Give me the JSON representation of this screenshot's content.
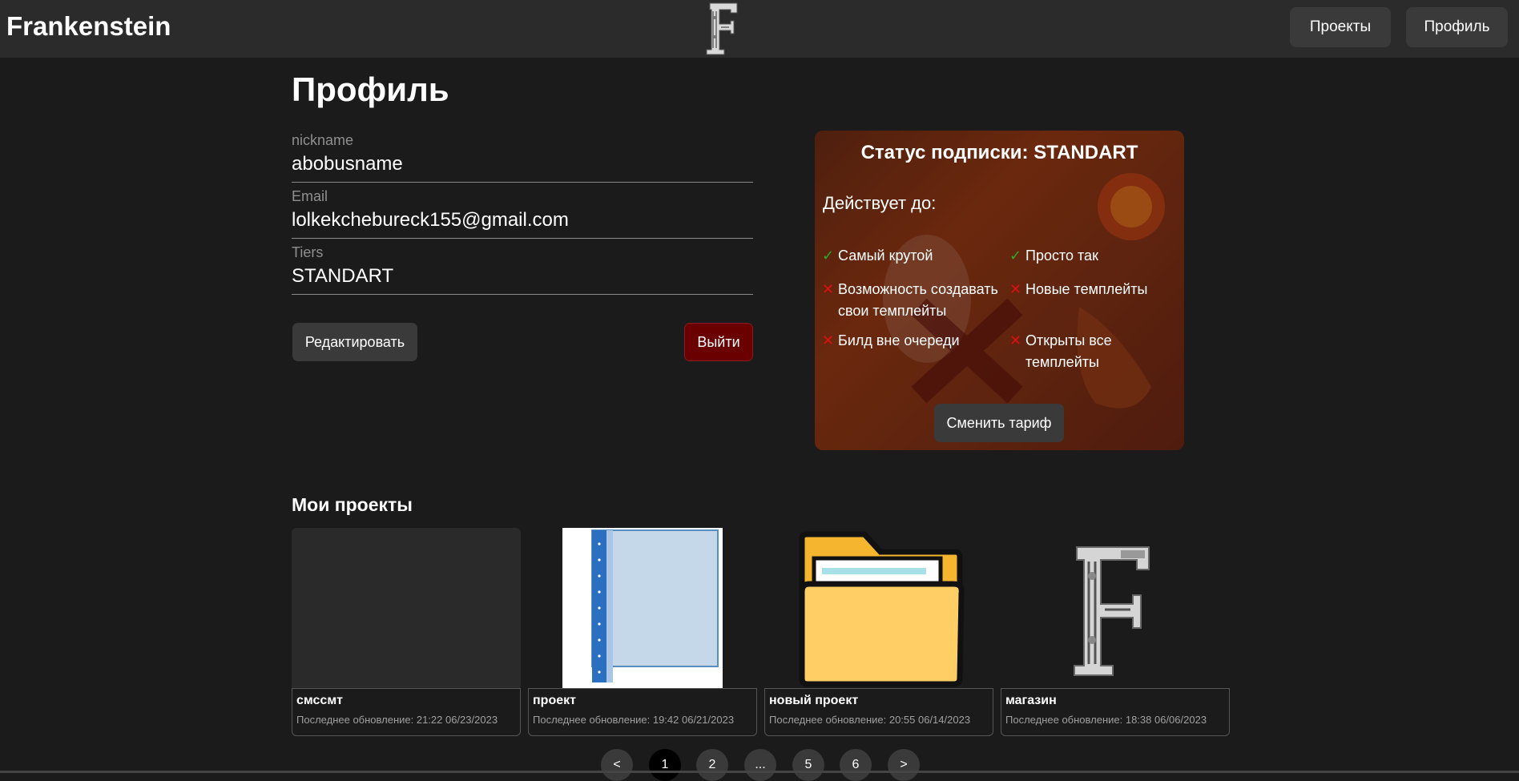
{
  "header": {
    "brand": "Frankenstein",
    "nav": {
      "projects": "Проекты",
      "profile": "Профиль"
    }
  },
  "profile": {
    "title": "Профиль",
    "fields": {
      "nickname": {
        "label": "nickname",
        "value": "abobusname"
      },
      "email": {
        "label": "Email",
        "value": "lolkekchebureck155@gmail.com"
      },
      "tiers": {
        "label": "Tiers",
        "value": "STANDART"
      }
    },
    "edit_button": "Редактировать",
    "logout_button": "Выйти"
  },
  "subscription": {
    "title": "Статус подписки: STANDART",
    "valid_until": "Действует до:",
    "features": [
      {
        "text": "Самый крутой",
        "enabled": true
      },
      {
        "text": "Просто так",
        "enabled": true
      },
      {
        "text": "Возможность создавать свои темплейты",
        "enabled": false
      },
      {
        "text": "Новые темплейты",
        "enabled": false
      },
      {
        "text": "Билд вне очереди",
        "enabled": false
      },
      {
        "text": "Открыты все темплейты",
        "enabled": false
      }
    ],
    "marks": {
      "check": "✓",
      "cross": "✕"
    },
    "change_button": "Сменить тариф"
  },
  "projects": {
    "heading": "Мои проекты",
    "items": [
      {
        "name": "смссмт",
        "updated": "Последнее обновление: 21:22 06/23/2023",
        "thumb": "empty"
      },
      {
        "name": "проект",
        "updated": "Последнее обновление: 19:42 06/21/2023",
        "thumb": "folder-file-icon"
      },
      {
        "name": "новый проект",
        "updated": "Последнее обновление: 20:55 06/14/2023",
        "thumb": "folder-icon"
      },
      {
        "name": "магазин",
        "updated": "Последнее обновление: 18:38 06/06/2023",
        "thumb": "frankenstein-logo"
      }
    ]
  },
  "pagination": {
    "prev": "<",
    "pages": [
      "1",
      "2",
      "...",
      "5",
      "6"
    ],
    "next": ">",
    "active": "1"
  }
}
